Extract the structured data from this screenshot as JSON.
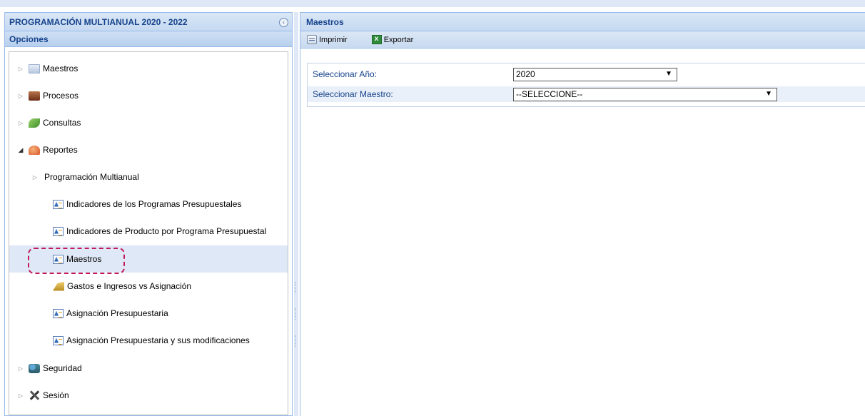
{
  "left_panel": {
    "title": "PROGRAMACIÓN MULTIANUAL 2020 - 2022",
    "collapse_icon": "chevron-left-circle-icon",
    "options_label": "Opciones"
  },
  "tree": {
    "maestros": "Maestros",
    "procesos": "Procesos",
    "consultas": "Consultas",
    "reportes": "Reportes",
    "programacion_multianual": "Programación Multianual",
    "indicadores_programas": "Indicadores de los Programas Presupuestales",
    "indicadores_producto": "Indicadores de Producto por Programa Presupuestal",
    "maestros_report": "Maestros",
    "gastos_ingresos": "Gastos e Ingresos vs Asignación",
    "asignacion": "Asignación Presupuestaria",
    "asignacion_modificaciones": "Asignación Presupuestaria y sus modificaciones",
    "seguridad": "Seguridad",
    "sesion": "Sesión"
  },
  "right_panel": {
    "title": "Maestros",
    "toolbar": {
      "print_label": "Imprimir",
      "export_label": "Exportar"
    },
    "form": {
      "year_label": "Seleccionar Año:",
      "year_value": "2020",
      "master_label": "Seleccionar Maestro:",
      "master_value": "--SELECCIONE--"
    }
  },
  "colors": {
    "header_text": "#15428b",
    "panel_border": "#99bbe8",
    "selection_bg": "#dfe8f6",
    "highlight_dashed": "#c2185b"
  }
}
